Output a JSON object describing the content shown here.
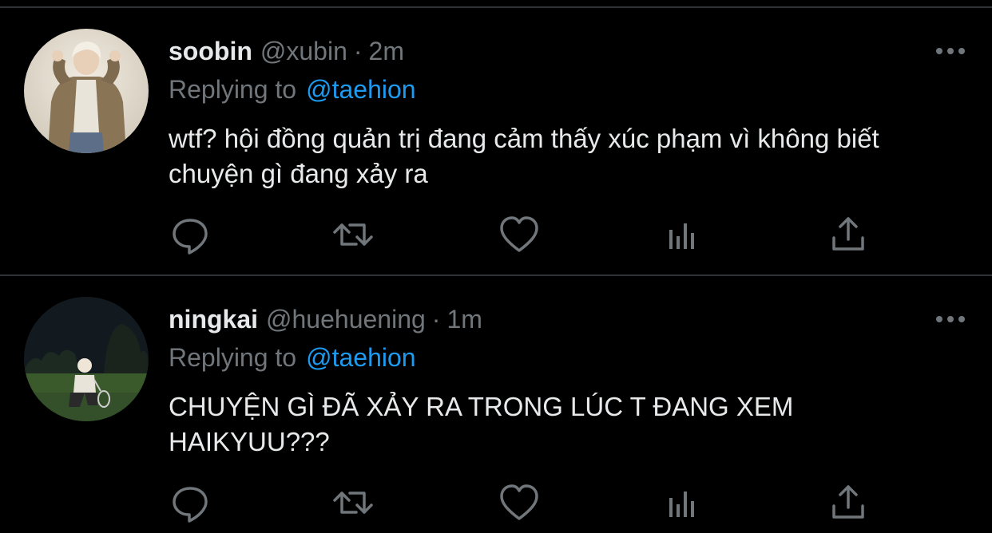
{
  "tweets": [
    {
      "name": "soobin",
      "handle": "@xubin",
      "separator": "·",
      "time": "2m",
      "replying_prefix": "Replying to",
      "replying_to": "@taehion",
      "text": "wtf? hội đồng quản trị đang cảm thấy xúc phạm vì không biết chuyện gì đang xảy ra"
    },
    {
      "name": "ningkai",
      "handle": "@huehuening",
      "separator": "·",
      "time": "1m",
      "replying_prefix": "Replying to",
      "replying_to": "@taehion",
      "text": "CHUYỆN GÌ ĐÃ XẢY RA TRONG LÚC T ĐANG XEM HAIKYUU???"
    }
  ],
  "icons": {
    "more": "more-horizontal-icon",
    "reply": "reply-icon",
    "retweet": "retweet-icon",
    "like": "heart-icon",
    "analytics": "analytics-icon",
    "share": "share-icon"
  },
  "colors": {
    "background": "#000000",
    "divider": "#2f3336",
    "primary_text": "#e7e9ea",
    "secondary_text": "#71767b",
    "mention": "#1d9bf0",
    "icon": "#71767b"
  }
}
